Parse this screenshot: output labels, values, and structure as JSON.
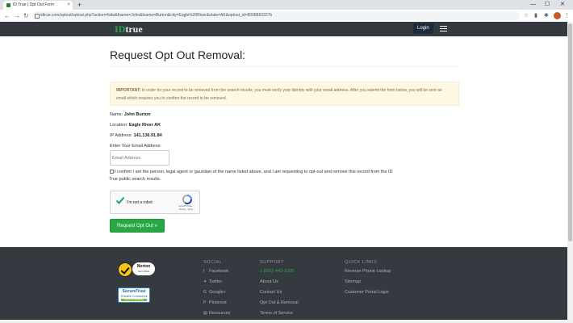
{
  "browser": {
    "tab_title": "ID True | Opt Out Form",
    "url": "idtrue.com/optout/optout.php?action=hide&fname=John&lname=Burton&city=Eagle%20River&state=AK&optout_id=8008893327b",
    "new_tab": "+",
    "tab_close": "×",
    "back": "←",
    "forward": "→",
    "reload": "↻",
    "minimize": "—",
    "maximize": "☐",
    "close": "✕"
  },
  "header": {
    "logo_id": "ID",
    "logo_true": "true",
    "login_label": "Login"
  },
  "main": {
    "title": "Request Opt Out Removal:",
    "alert_strong": "IMPORTANT:",
    "alert_text": " In order for your record to be removed from the search results, you must verify your identity with your email address. After you submit the form below, you will be sent an email which requires you to confirm the record to be removed.",
    "name_label": "Name:",
    "name_value": "John Burton",
    "location_label": "Location:",
    "location_value": "Eagle River AK",
    "ip_label": "IP Address:",
    "ip_value": "141.136.91.84",
    "email_label": "Enter Your Email Address:",
    "email_placeholder": "Email Address",
    "consent_text": "I confirm I am the person, legal agent or gaurdian of the name listed above, and I am requesting to opt-out and remove this record from the ID True public search results.",
    "captcha_label": "I'm not a robot",
    "captcha_brand": "reCAPTCHA",
    "captcha_links": "Privacy - Terms",
    "submit_label": "Request Opt Out »"
  },
  "footer": {
    "norton_brand": "Norton",
    "norton_sub": "SECURED",
    "securetrust_brand": "SecureTrust",
    "securetrust_sub": "Trusted Commerce",
    "securetrust_bar": "CLICK TO VALIDATE",
    "social_head": "SOCIAL",
    "social": [
      "Facebook",
      "Twitter",
      "Google+",
      "Pinterest",
      "Resources"
    ],
    "support_head": "SUPPORT",
    "support_phone": "1 (800) 443-2205",
    "support": [
      "About Us",
      "Contact Us",
      "Opt Out & Removal",
      "Terms of Service"
    ],
    "quick_head": "QUICK LINKS",
    "quick": [
      "Reverse Phone Lookup",
      "Sitemap",
      "Customer Portal Login"
    ]
  },
  "colors": {
    "brand_green": "#28a745",
    "header_bg": "#343a40",
    "alert_bg": "#fcf8e3"
  }
}
